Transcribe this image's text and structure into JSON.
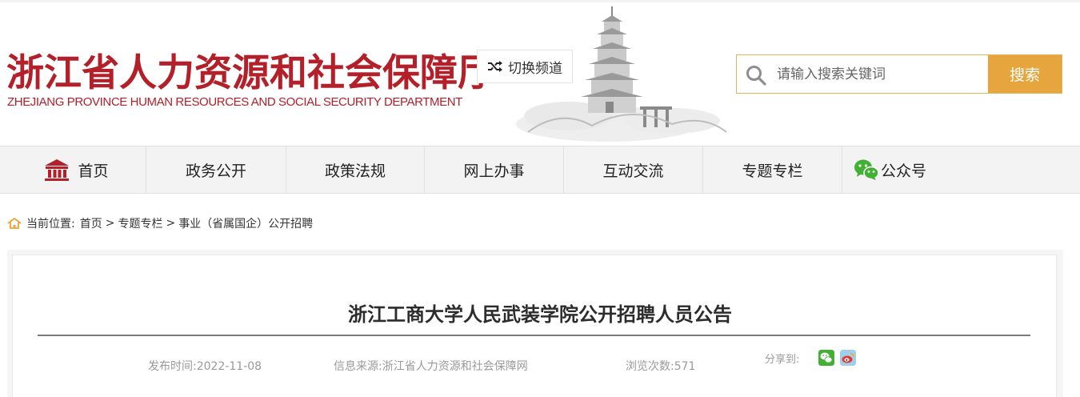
{
  "header": {
    "logo_cn": "浙江省人力资源和社会保障厅",
    "logo_en": "ZHEJIANG PROVINCE HUMAN RESOURCES AND SOCIAL SECURITY DEPARTMENT",
    "switch_label": "切换频道",
    "search_placeholder": "请输入搜索关键词",
    "search_button": "搜索",
    "brand_color": "#b3202a",
    "accent_color": "#e7a53e"
  },
  "nav": {
    "items": [
      {
        "label": "首页",
        "icon": "home-building-icon"
      },
      {
        "label": "政务公开"
      },
      {
        "label": "政策法规"
      },
      {
        "label": "网上办事"
      },
      {
        "label": "互动交流"
      },
      {
        "label": "专题专栏"
      },
      {
        "label": "公众号",
        "icon": "wechat-icon"
      }
    ]
  },
  "breadcrumb": {
    "prefix": "当前位置:",
    "items": [
      "首页",
      "专题专栏",
      "事业（省属国企）公开招聘"
    ],
    "separator": ">"
  },
  "article": {
    "title": "浙江工商大学人民武装学院公开招聘人员公告",
    "publish_time": "发布时间:2022-11-08",
    "source": "信息来源:浙江省人力资源和社会保障网",
    "views": "浏览次数:571",
    "share_label": "分享到:",
    "share_icons": [
      "wechat-share-icon",
      "weibo-share-icon"
    ]
  }
}
